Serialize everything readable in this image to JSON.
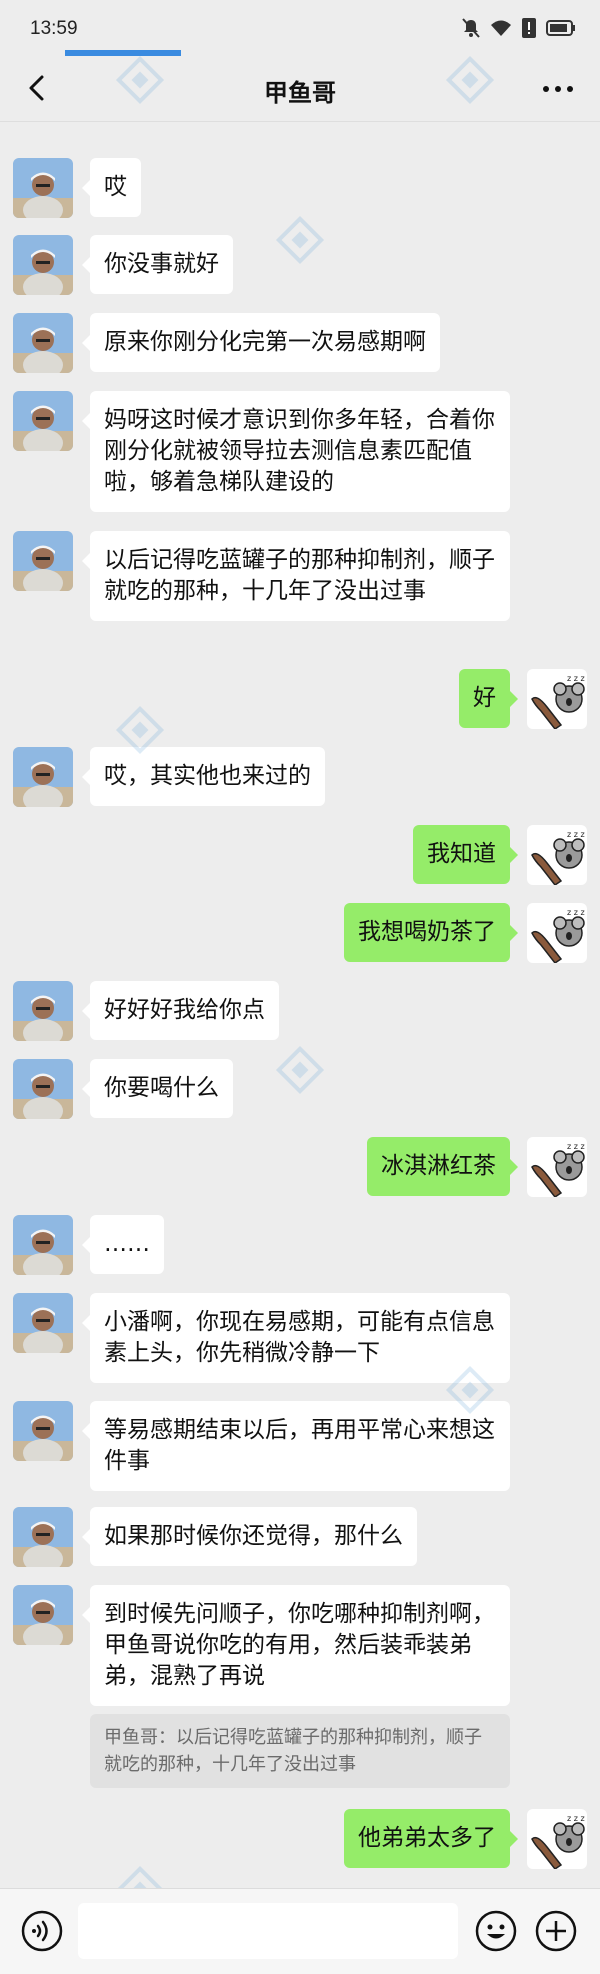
{
  "status": {
    "time": "13:59"
  },
  "nav": {
    "title": "甲鱼哥"
  },
  "messages": [
    {
      "side": "left",
      "text": "哎"
    },
    {
      "side": "left",
      "text": "你没事就好"
    },
    {
      "side": "left",
      "text": "原来你刚分化完第一次易感期啊"
    },
    {
      "side": "left",
      "text": "妈呀这时候才意识到你多年轻，合着你刚分化就被领导拉去测信息素匹配值啦，够着急梯队建设的"
    },
    {
      "side": "left",
      "text": "以后记得吃蓝罐子的那种抑制剂，顺子就吃的那种，十几年了没出过事"
    },
    {
      "side": "right",
      "text": "好"
    },
    {
      "side": "left",
      "text": "哎，其实他也来过的"
    },
    {
      "side": "right",
      "text": "我知道"
    },
    {
      "side": "right",
      "text": "我想喝奶茶了"
    },
    {
      "side": "left",
      "text": "好好好我给你点"
    },
    {
      "side": "left",
      "text": "你要喝什么"
    },
    {
      "side": "right",
      "text": "冰淇淋红茶"
    },
    {
      "side": "left",
      "text": "……"
    },
    {
      "side": "left",
      "text": "小潘啊，你现在易感期，可能有点信息素上头，你先稍微冷静一下"
    },
    {
      "side": "left",
      "text": "等易感期结束以后，再用平常心来想这件事"
    },
    {
      "side": "left",
      "text": "如果那时候你还觉得，那什么"
    },
    {
      "side": "left",
      "text": "到时候先问顺子，你吃哪种抑制剂啊，甲鱼哥说你吃的有用，然后装乖装弟弟，混熟了再说"
    },
    {
      "side": "right",
      "text": "他弟弟太多了"
    }
  ],
  "quote": {
    "text": "甲鱼哥：以后记得吃蓝罐子的那种抑制剂，顺子就吃的那种，十几年了没出过事"
  },
  "colors": {
    "bubble_self": "#95ec69",
    "bubble_other": "#ffffff",
    "background": "#ededed"
  },
  "icons": {
    "back": "back-arrow-icon",
    "more": "more-icon",
    "voice": "voice-icon",
    "emoji": "emoji-icon",
    "plus": "plus-icon"
  }
}
